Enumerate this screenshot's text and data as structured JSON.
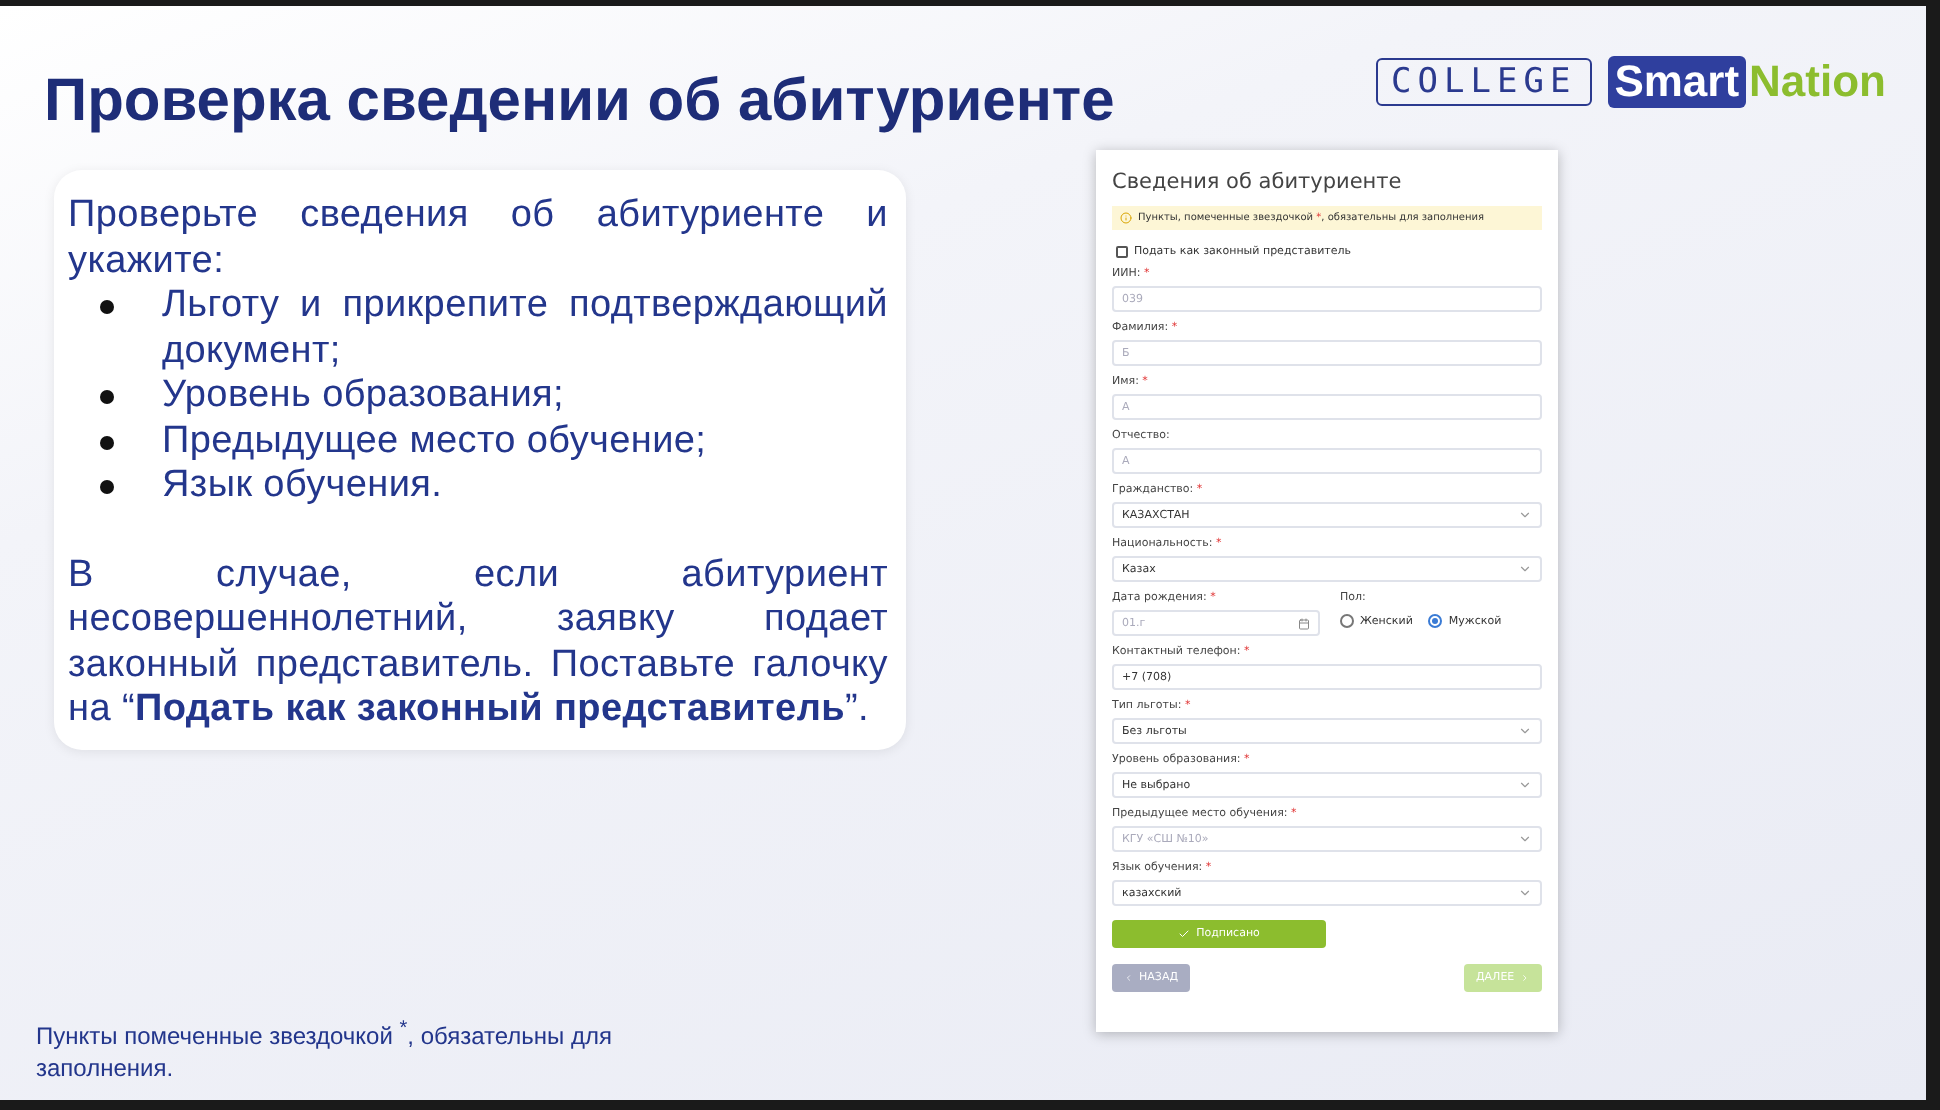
{
  "slide": {
    "title": "Проверка сведении об абитуриенте",
    "logo": {
      "college": "COLLEGE",
      "smart": "Smart",
      "nation": "Nation"
    },
    "instructions": {
      "intro": "Проверьте сведения об абитуриенте и укажите:",
      "bullets": [
        "Льготу и прикрепите подтверждающий документ;",
        "Уровень образования;",
        "Предыдущее место обучение;",
        "Язык обучения."
      ],
      "note": "В случае, если абитуриент несовершеннолетний, заявку подает законный представитель. Поставьте галочку на “**Подать как законный представитель**”."
    },
    "footnote": "Пункты помеченные звездочкой $^{*}$, обязательны для заполнения."
  },
  "form": {
    "title": "Сведения об абитуриенте",
    "notice": {
      "before": "Пункты, помеченные звездочкой",
      "star": "*",
      "after": ", обязательны для заполнения"
    },
    "representative": {
      "label": "Подать как законный представитель",
      "checked": false
    },
    "fields": [
      {
        "kind": "input",
        "label": "ИИН:",
        "required": true,
        "value": "039",
        "disabled": true
      },
      {
        "kind": "input",
        "label": "Фамилия:",
        "required": true,
        "value": "Б",
        "disabled": true
      },
      {
        "kind": "input",
        "label": "Имя:",
        "required": true,
        "value": "А",
        "disabled": true
      },
      {
        "kind": "input",
        "label": "Отчество:",
        "required": false,
        "value": "А",
        "disabled": true
      },
      {
        "kind": "select",
        "label": "Гражданство:",
        "required": true,
        "value": "КАЗАХСТАН",
        "disabled": false
      },
      {
        "kind": "select",
        "label": "Национальность:",
        "required": true,
        "value": "Казах",
        "disabled": false
      },
      {
        "kind": "date-gender",
        "label": "Дата рождения:",
        "required": true,
        "value": "01.г",
        "disabled": true,
        "gender_label": "Пол:",
        "options": [
          {
            "label": "Женский",
            "selected": false
          },
          {
            "label": "Мужской",
            "selected": true
          }
        ]
      },
      {
        "kind": "input",
        "label": "Контактный телефон:",
        "required": true,
        "value": "+7 (708)",
        "disabled": false
      },
      {
        "kind": "select",
        "label": "Тип льготы:",
        "required": true,
        "value": "Без льготы",
        "disabled": false
      },
      {
        "kind": "select",
        "label": "Уровень образования:",
        "required": true,
        "value": "Не выбрано",
        "disabled": false
      },
      {
        "kind": "select",
        "label": "Предыдущее место обучения:",
        "required": true,
        "value": "КГУ «СШ №10»",
        "disabled": true
      },
      {
        "kind": "select",
        "label": "Язык обучения:",
        "required": true,
        "value": "казахский",
        "disabled": false
      }
    ],
    "signed_button": "Подписано",
    "back_button": {
      "label": "НАЗАД",
      "disabled": false
    },
    "next_button": {
      "label": "ДАЛЕЕ",
      "disabled": true
    }
  }
}
